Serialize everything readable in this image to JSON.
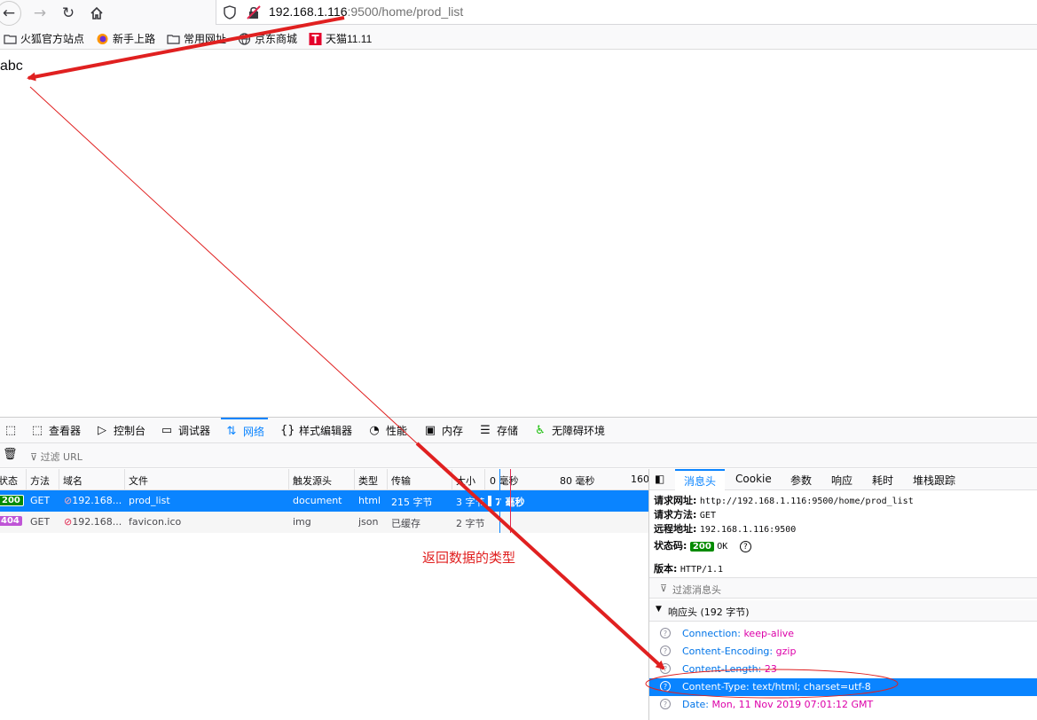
{
  "browser": {
    "url_host": "192.168.1.116",
    "url_rest": ":9500/home/prod_list",
    "bookmarks": [
      "火狐官方站点",
      "新手上路",
      "常用网址",
      "京东商城",
      "天猫11.11"
    ]
  },
  "page": {
    "body_text": "abc"
  },
  "devtools": {
    "tabs": [
      "查看器",
      "控制台",
      "调试器",
      "网络",
      "样式编辑器",
      "性能",
      "内存",
      "存储",
      "无障碍环境"
    ],
    "filter_placeholder": "过滤 URL",
    "columns": [
      "状态",
      "方法",
      "域名",
      "文件",
      "触发源头",
      "类型",
      "传输",
      "大小"
    ],
    "timeline_ticks": [
      "0 毫秒",
      "80 毫秒",
      "160"
    ],
    "requests": [
      {
        "status": "200",
        "method": "GET",
        "domain": "192.168....",
        "file": "prod_list",
        "cause": "document",
        "type": "html",
        "transferred": "215 字节",
        "size": "3 字节",
        "timing": "7 毫秒"
      },
      {
        "status": "404",
        "method": "GET",
        "domain": "192.168....",
        "file": "favicon.ico",
        "cause": "img",
        "type": "json",
        "transferred": "已缓存",
        "size": "2 字节",
        "timing": ""
      }
    ],
    "side_tabs": [
      "消息头",
      "Cookie",
      "参数",
      "响应",
      "耗时",
      "堆栈跟踪"
    ],
    "request_url_label": "请求网址:",
    "request_url": "http://192.168.1.116:9500/home/prod_list",
    "request_method_label": "请求方法:",
    "request_method": "GET",
    "remote_addr_label": "远程地址:",
    "remote_addr": "192.168.1.116:9500",
    "status_label": "状态码:",
    "status_code": "200",
    "status_text": "OK",
    "version_label": "版本:",
    "version": "HTTP/1.1",
    "filter_headers": "过滤消息头",
    "response_headers_title": "响应头 (192 字节)",
    "response_headers": [
      {
        "name": "Connection:",
        "value": "keep-alive"
      },
      {
        "name": "Content-Encoding:",
        "value": "gzip"
      },
      {
        "name": "Content-Length:",
        "value": "23"
      },
      {
        "name": "Content-Type:",
        "value": "text/html; charset=utf-8"
      },
      {
        "name": "Date:",
        "value": "Mon, 11 Nov 2019 07:01:12 GMT"
      }
    ]
  },
  "annotation": {
    "text": "返回数据的类型"
  },
  "colors": {
    "accent": "#0a84ff",
    "annotation": "#e02020",
    "ok_badge": "#058b00",
    "notfound_badge": "#bf55d6"
  }
}
